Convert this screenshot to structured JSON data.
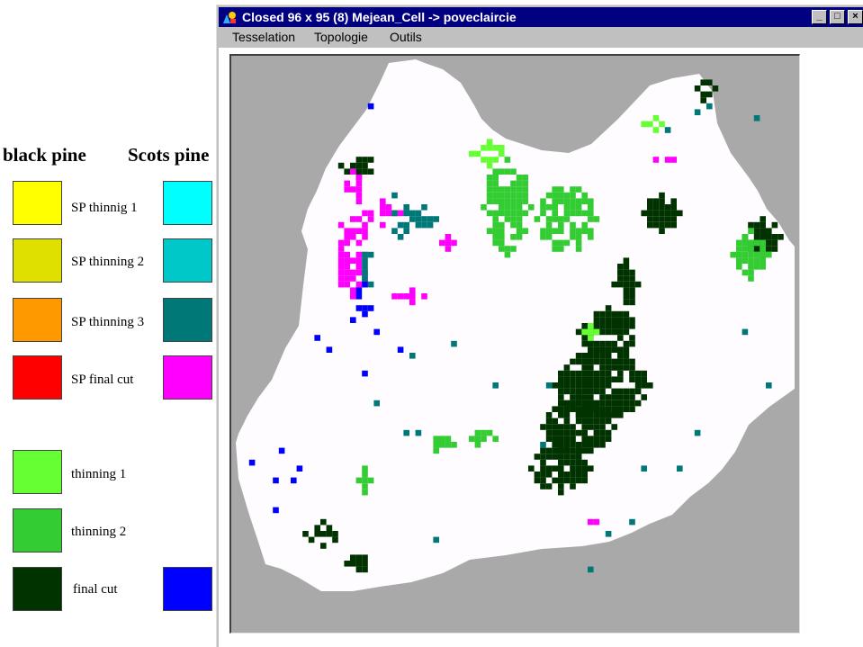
{
  "legend": {
    "header_black_pine": "black pine",
    "header_scots_pine": "Scots pine",
    "rows": [
      {
        "label": "SP thinnig 1",
        "black_pine_color": "#ffff00",
        "scots_pine_color": "#00ffff"
      },
      {
        "label": "SP thinning 2",
        "black_pine_color": "#e0e000",
        "scots_pine_color": "#00c8c8"
      },
      {
        "label": "SP thinning 3",
        "black_pine_color": "#ff9900",
        "scots_pine_color": "#007878"
      },
      {
        "label": "SP final cut",
        "black_pine_color": "#ff0000",
        "scots_pine_color": "#ff00ff"
      },
      {
        "label": "thinning 1",
        "black_pine_color": "#66ff33",
        "scots_pine_color": null
      },
      {
        "label": "thinning 2",
        "black_pine_color": "#33cc33",
        "scots_pine_color": null
      },
      {
        "label": "final cut",
        "black_pine_color": "#003300",
        "scots_pine_color": "#0000ff"
      }
    ]
  },
  "window": {
    "title": "Closed 96 x 95 (8)  Mejean_Cell -> poveclaircie",
    "buttons": {
      "minimize": "_",
      "maximize": "□",
      "close": "×"
    },
    "menu": [
      "Tesselation",
      "Topologie",
      "Outils"
    ]
  },
  "map": {
    "grid_size": "96 x 95",
    "background_color": "#a9a9a9",
    "stand_color": "#fffcff"
  }
}
